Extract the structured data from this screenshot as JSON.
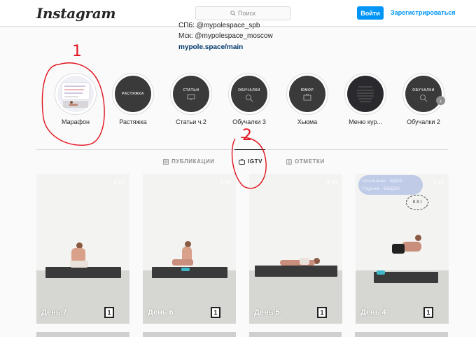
{
  "header": {
    "logo": "Instagram",
    "search_placeholder": "Поиск",
    "login_label": "Войти",
    "signup_label": "Зарегистрироваться"
  },
  "bio": {
    "line_spb": "СПб: @mypolespace_spb",
    "line_msk": "Мск: @mypolespace_moscow",
    "link": "mypole.space/main"
  },
  "highlights": [
    {
      "label": "Марафон",
      "cover": ""
    },
    {
      "label": "Растяжка",
      "cover": "РАСТЯЖКА"
    },
    {
      "label": "Статьи ч.2",
      "cover": "СТАТЬИ"
    },
    {
      "label": "Обучалки 3",
      "cover": "ОБУЧАЛКИ"
    },
    {
      "label": "Хьюма",
      "cover": "ЮМОР"
    },
    {
      "label": "Меню кур...",
      "cover": ""
    },
    {
      "label": "Обучалки 2",
      "cover": "ОБУЧАЛКИ"
    }
  ],
  "tabs": [
    {
      "label": "ПУБЛИКАЦИИ",
      "active": false
    },
    {
      "label": "IGTV",
      "active": true
    },
    {
      "label": "ОТМЕТКИ",
      "active": false
    }
  ],
  "videos": [
    {
      "title": "День 7",
      "duration": "4:03",
      "badge": "1"
    },
    {
      "title": "День 6",
      "duration": "1:39",
      "badge": "1"
    },
    {
      "title": "День 5",
      "duration": "4:38",
      "badge": "1"
    },
    {
      "title": "День 4",
      "duration": "1:43",
      "badge": "1",
      "overlay_line1": "Осознание - ВДОХ",
      "overlay_line2": "Подъем - ВЫДОХ",
      "overlay_mark": "II X I"
    }
  ],
  "annotations": {
    "one": "1",
    "two": "2"
  },
  "colors": {
    "accent": "#0095f6",
    "annotation": "#e0141e"
  }
}
